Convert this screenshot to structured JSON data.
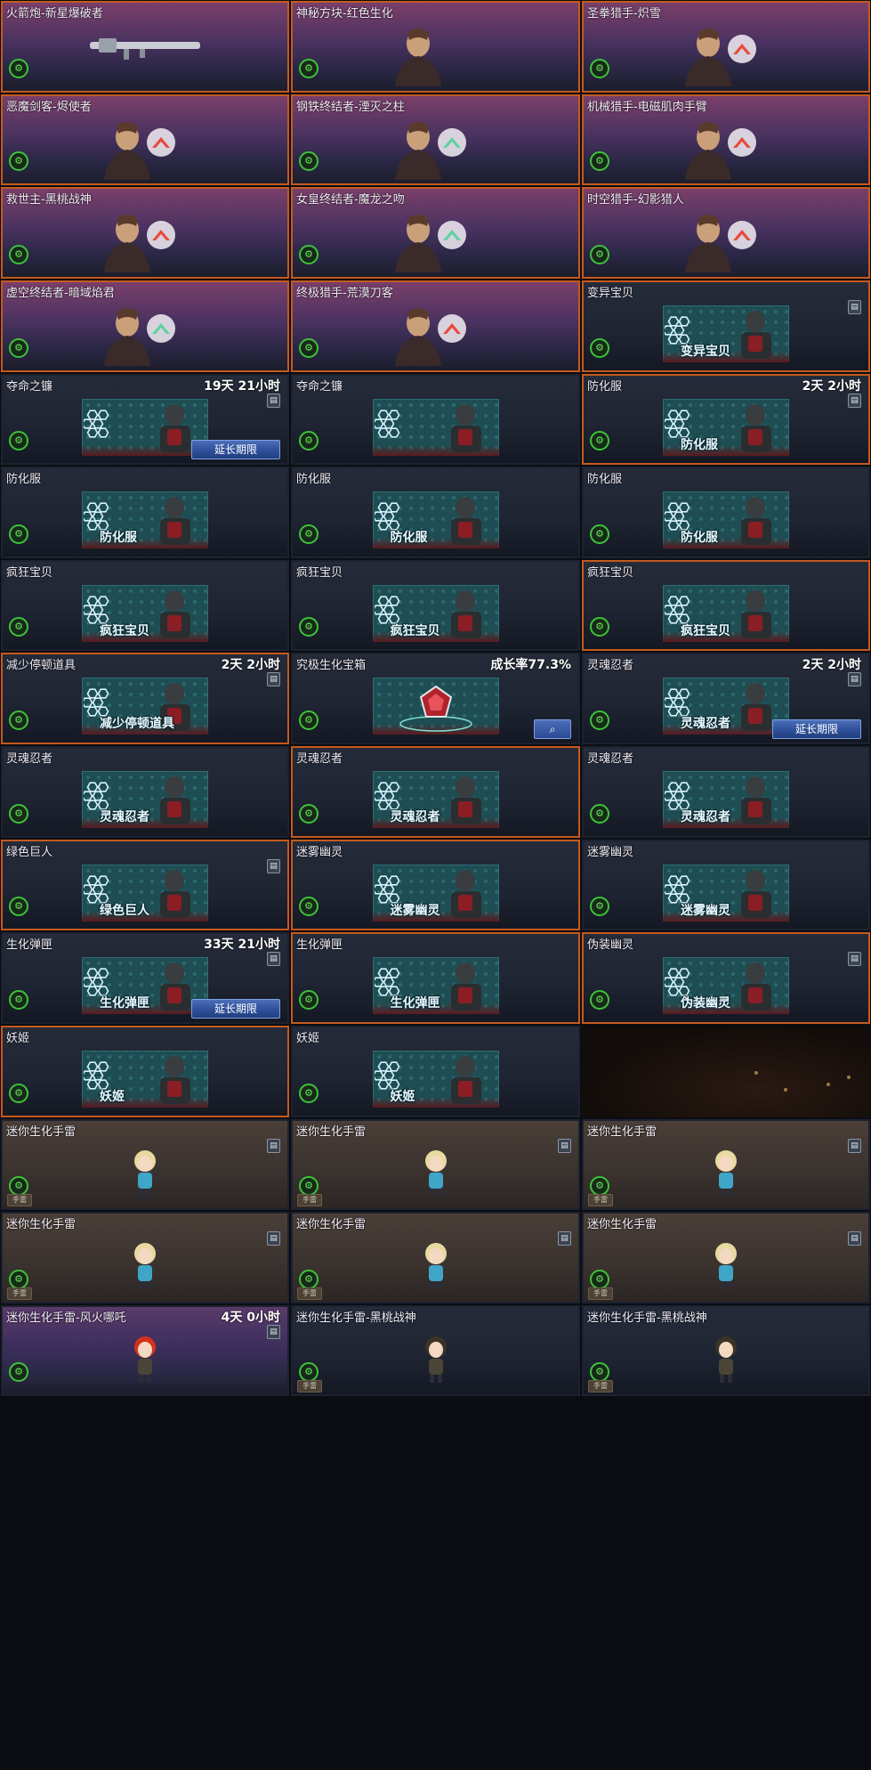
{
  "labels": {
    "extend": "延长期限",
    "grenade_tag": "手雷"
  },
  "colors": {
    "selected_border": "#c45a1e",
    "equip_ring": "#3fc23a",
    "button_blue": "#2e4f99"
  },
  "items": [
    {
      "name": "火箭炮-新星爆破者",
      "bg": "pink",
      "selected": true,
      "art": "weapon",
      "icon": "rocket-launcher-icon"
    },
    {
      "name": "神秘方块-红色生化",
      "bg": "pink",
      "selected": true,
      "art": "vip",
      "icon": "mystery-cube-icon"
    },
    {
      "name": "圣拳猎手-炽雪",
      "bg": "pink",
      "selected": true,
      "art": "vip",
      "icon": "character-icon",
      "badge": "red"
    },
    {
      "name": "恶魔剑客-烬使者",
      "bg": "pink",
      "selected": true,
      "art": "vip",
      "icon": "character-icon",
      "badge": "red"
    },
    {
      "name": "钢铁终结者-湮灭之柱",
      "bg": "pink",
      "selected": true,
      "art": "vip",
      "icon": "character-icon",
      "badge": "green"
    },
    {
      "name": "机械猎手-电磁肌肉手臂",
      "bg": "pink",
      "selected": true,
      "art": "vip",
      "icon": "character-icon",
      "badge": "red"
    },
    {
      "name": "救世主-黑桃战神",
      "bg": "pink",
      "selected": true,
      "art": "vip",
      "icon": "character-icon",
      "badge": "red"
    },
    {
      "name": "女皇终结者-魔龙之吻",
      "bg": "pink",
      "selected": true,
      "art": "vip",
      "icon": "character-icon",
      "badge": "green"
    },
    {
      "name": "时空猎手-幻影猎人",
      "bg": "pink",
      "selected": true,
      "art": "vip",
      "icon": "character-icon",
      "badge": "red"
    },
    {
      "name": "虚空终结者-暗域焰君",
      "bg": "pink",
      "selected": true,
      "art": "vip",
      "icon": "character-icon",
      "badge": "green"
    },
    {
      "name": "终极猎手-荒漠刀客",
      "bg": "pink",
      "selected": true,
      "art": "vip",
      "icon": "character-icon",
      "badge": "red"
    },
    {
      "name": "变异宝贝",
      "bg": "slate",
      "selected": true,
      "art": "panel",
      "label": "变异宝贝",
      "trash": true,
      "icon": "mutant-baby-icon"
    },
    {
      "name": "夺命之镰",
      "bg": "slate",
      "selected": false,
      "art": "panel",
      "label": "",
      "timer": "19天 21小时",
      "trash": true,
      "extend": true,
      "icon": "scythe-icon"
    },
    {
      "name": "夺命之镰",
      "bg": "slate",
      "selected": false,
      "art": "panel",
      "label": "",
      "icon": "scythe-icon"
    },
    {
      "name": "防化服",
      "bg": "slate",
      "selected": true,
      "art": "panel",
      "label": "防化服",
      "timer": "2天 2小时",
      "trash": true,
      "icon": "hazmat-suit-icon"
    },
    {
      "name": "防化服",
      "bg": "slate",
      "selected": false,
      "art": "panel",
      "label": "防化服",
      "icon": "hazmat-suit-icon"
    },
    {
      "name": "防化服",
      "bg": "slate",
      "selected": false,
      "art": "panel",
      "label": "防化服",
      "icon": "hazmat-suit-icon"
    },
    {
      "name": "防化服",
      "bg": "slate",
      "selected": false,
      "art": "panel",
      "label": "防化服",
      "icon": "hazmat-suit-icon"
    },
    {
      "name": "疯狂宝贝",
      "bg": "slate",
      "selected": false,
      "art": "panel",
      "label": "疯狂宝贝",
      "icon": "crazy-baby-icon"
    },
    {
      "name": "疯狂宝贝",
      "bg": "slate",
      "selected": false,
      "art": "panel",
      "label": "疯狂宝贝",
      "icon": "crazy-baby-icon"
    },
    {
      "name": "疯狂宝贝",
      "bg": "slate",
      "selected": true,
      "art": "panel",
      "label": "疯狂宝贝",
      "icon": "crazy-baby-icon"
    },
    {
      "name": "减少停顿道具",
      "bg": "slate",
      "selected": true,
      "art": "panel",
      "label": "减少停顿道具",
      "timer": "2天 2小时",
      "trash": true,
      "icon": "stun-reduce-icon"
    },
    {
      "name": "究极生化宝箱",
      "bg": "slate",
      "selected": false,
      "art": "chest",
      "timer": "成长率77.3%",
      "search": true,
      "icon": "bio-chest-icon"
    },
    {
      "name": "灵魂忍者",
      "bg": "slate",
      "selected": false,
      "art": "panel",
      "label": "灵魂忍者",
      "timer": "2天 2小时",
      "trash": true,
      "extend": true,
      "icon": "soul-ninja-icon"
    },
    {
      "name": "灵魂忍者",
      "bg": "slate",
      "selected": false,
      "art": "panel",
      "label": "灵魂忍者",
      "icon": "soul-ninja-icon"
    },
    {
      "name": "灵魂忍者",
      "bg": "slate",
      "selected": true,
      "art": "panel",
      "label": "灵魂忍者",
      "icon": "soul-ninja-icon"
    },
    {
      "name": "灵魂忍者",
      "bg": "slate",
      "selected": false,
      "art": "panel",
      "label": "灵魂忍者",
      "icon": "soul-ninja-icon"
    },
    {
      "name": "绿色巨人",
      "bg": "slate",
      "selected": true,
      "art": "panel",
      "label": "绿色巨人",
      "trash": true,
      "icon": "green-giant-icon"
    },
    {
      "name": "迷雾幽灵",
      "bg": "slate",
      "selected": true,
      "art": "panel",
      "label": "迷雾幽灵",
      "icon": "fog-ghost-icon"
    },
    {
      "name": "迷雾幽灵",
      "bg": "slate",
      "selected": false,
      "art": "panel",
      "label": "迷雾幽灵",
      "icon": "fog-ghost-icon"
    },
    {
      "name": "生化弹匣",
      "bg": "slate",
      "selected": false,
      "art": "panel",
      "label": "生化弹匣",
      "timer": "33天 21小时",
      "trash": true,
      "extend": true,
      "icon": "ammo-box-icon"
    },
    {
      "name": "生化弹匣",
      "bg": "slate",
      "selected": true,
      "art": "panel",
      "label": "生化弹匣",
      "icon": "ammo-box-icon"
    },
    {
      "name": "伪装幽灵",
      "bg": "slate",
      "selected": true,
      "art": "panel",
      "label": "伪装幽灵",
      "trash": true,
      "icon": "disguise-ghost-icon"
    },
    {
      "name": "妖姬",
      "bg": "slate",
      "selected": true,
      "art": "panel",
      "label": "妖姬",
      "icon": "siren-icon"
    },
    {
      "name": "妖姬",
      "bg": "slate",
      "selected": false,
      "art": "panel",
      "label": "妖姬",
      "icon": "siren-icon"
    },
    {
      "name": "",
      "bg": "empty"
    },
    {
      "name": "迷你生化手雷",
      "bg": "brown",
      "selected": false,
      "art": "chibi",
      "trash": true,
      "tag": true,
      "icon": "mini-bio-grenade-icon"
    },
    {
      "name": "迷你生化手雷",
      "bg": "brown",
      "selected": false,
      "art": "chibi",
      "trash": true,
      "tag": true,
      "icon": "mini-bio-grenade-icon"
    },
    {
      "name": "迷你生化手雷",
      "bg": "brown",
      "selected": false,
      "art": "chibi",
      "trash": true,
      "tag": true,
      "icon": "mini-bio-grenade-icon"
    },
    {
      "name": "迷你生化手雷",
      "bg": "brown",
      "selected": false,
      "art": "chibi",
      "trash": true,
      "tag": true,
      "icon": "mini-bio-grenade-icon"
    },
    {
      "name": "迷你生化手雷",
      "bg": "brown",
      "selected": false,
      "art": "chibi",
      "trash": true,
      "tag": true,
      "icon": "mini-bio-grenade-icon"
    },
    {
      "name": "迷你生化手雷",
      "bg": "brown",
      "selected": false,
      "art": "chibi",
      "trash": true,
      "tag": true,
      "icon": "mini-bio-grenade-icon"
    },
    {
      "name": "迷你生化手雷-风火哪吒",
      "bg": "pink",
      "selected": false,
      "art": "chibi",
      "timer": "4天 0小时",
      "trash": true,
      "icon": "nezha-grenade-icon",
      "hair": "#d2321e"
    },
    {
      "name": "迷你生化手雷-黑桃战神",
      "bg": "slate",
      "selected": false,
      "art": "chibi",
      "tag": true,
      "icon": "spade-grenade-icon",
      "hair": "#3a3326"
    },
    {
      "name": "迷你生化手雷-黑桃战神",
      "bg": "slate",
      "selected": false,
      "art": "chibi",
      "tag": true,
      "icon": "spade-grenade-icon",
      "hair": "#3a3326"
    }
  ]
}
